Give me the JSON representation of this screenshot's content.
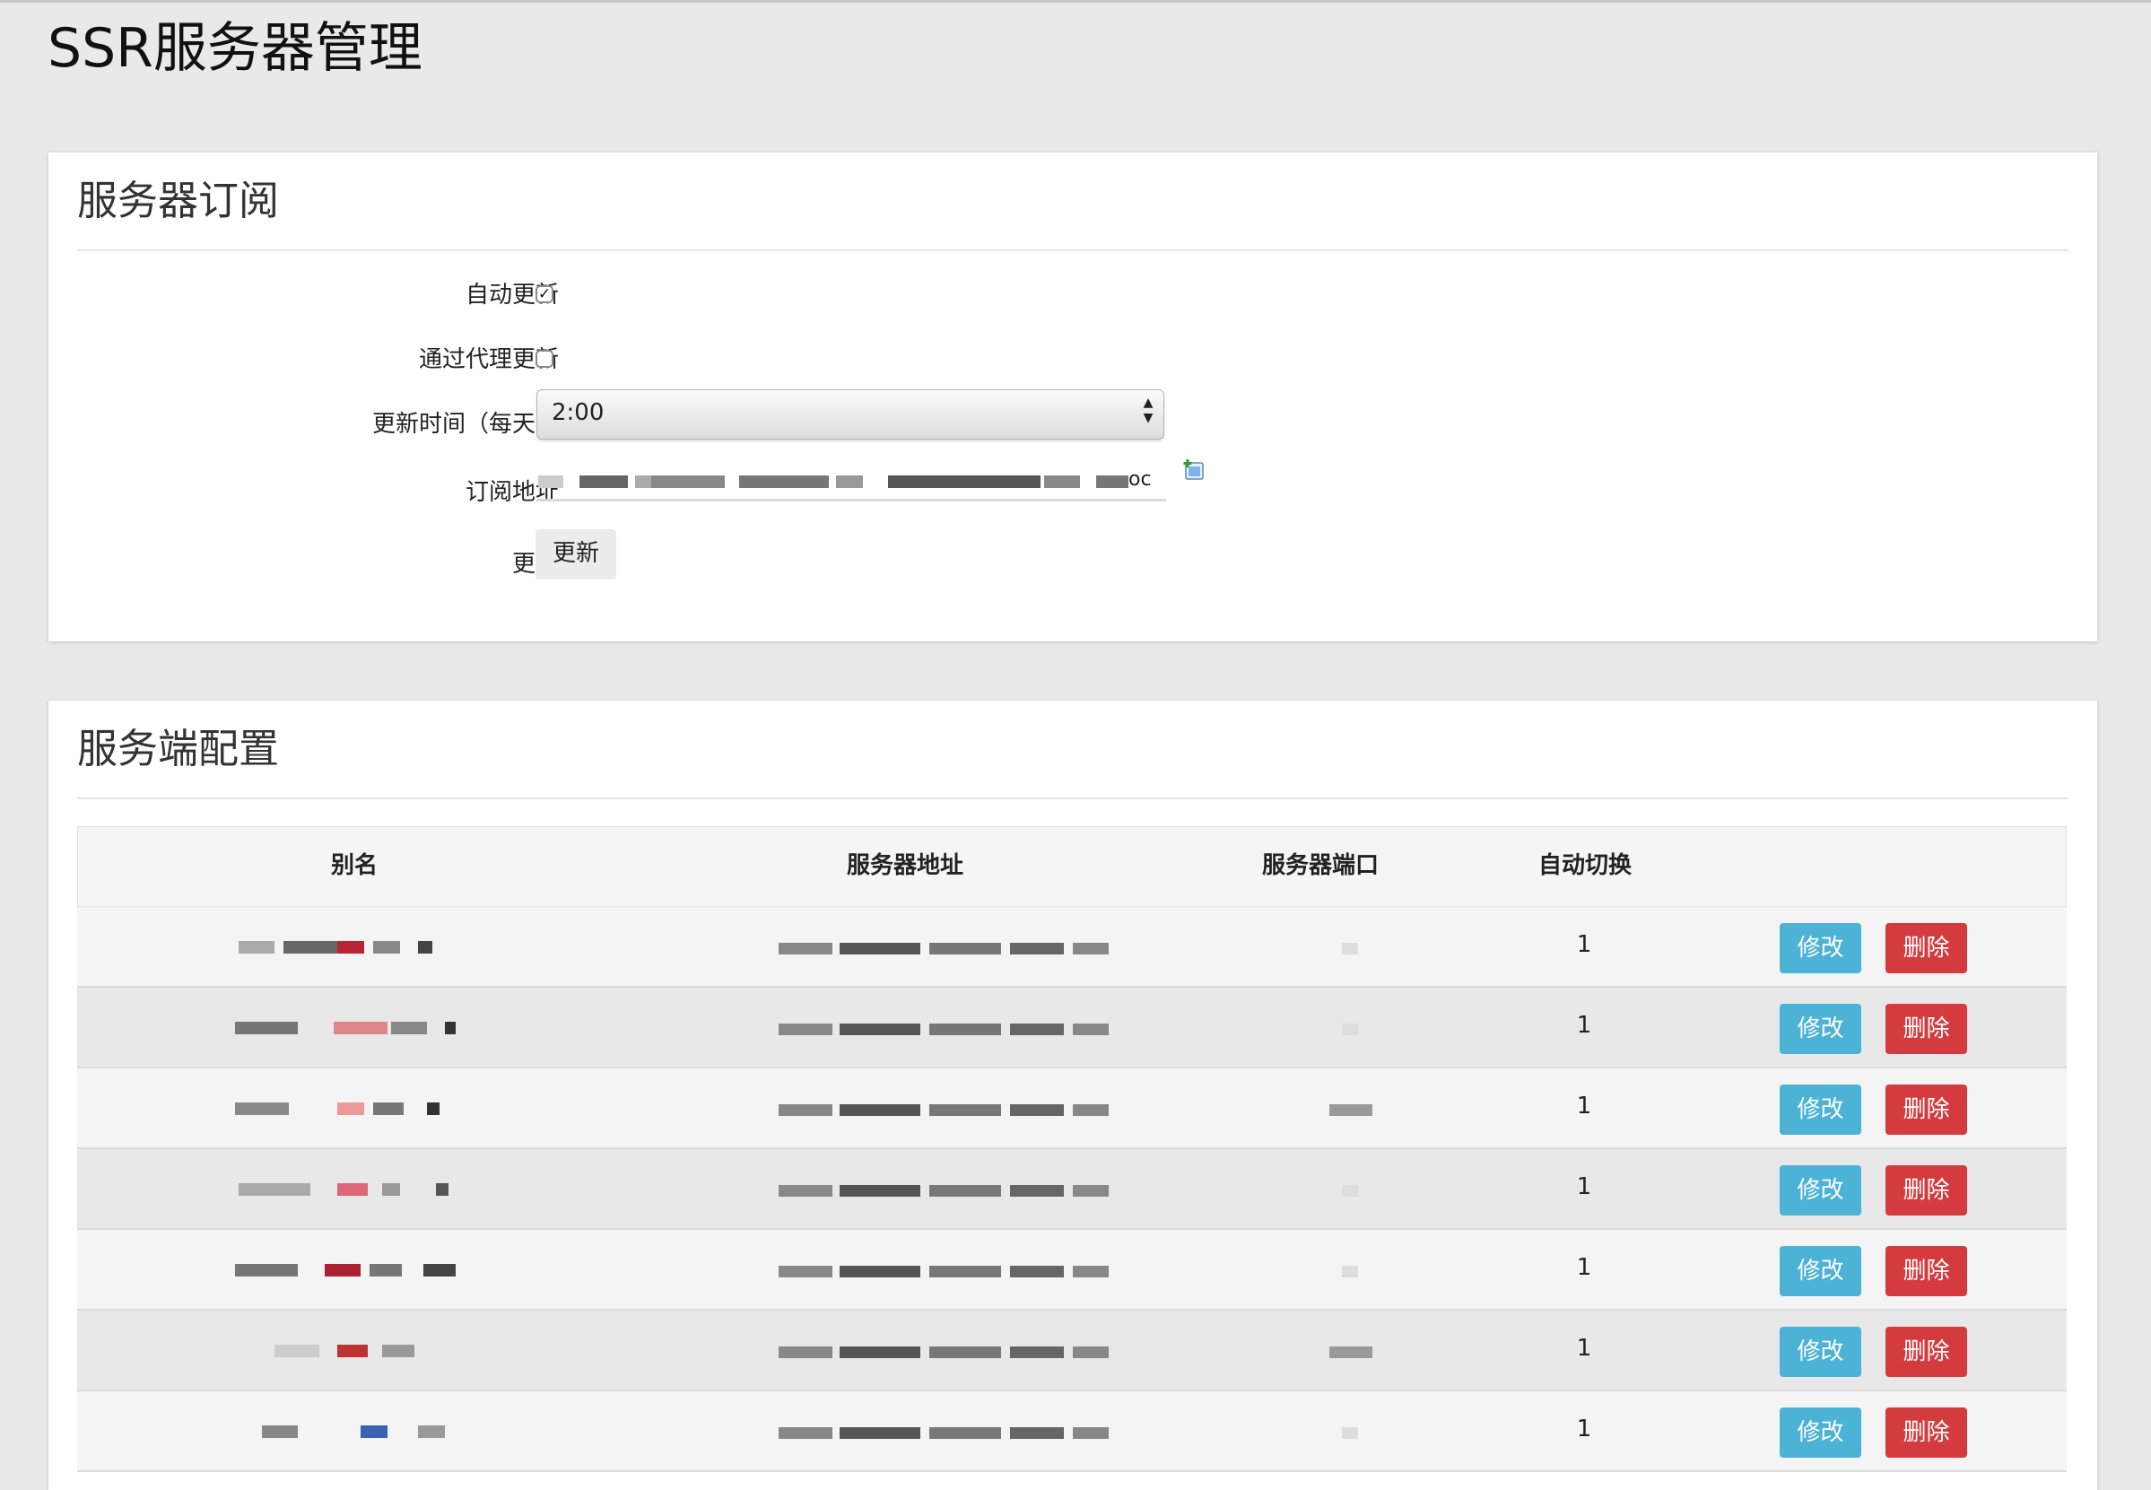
{
  "page": {
    "title": "SSR服务器管理"
  },
  "subscription": {
    "title": "服务器订阅",
    "auto_update_label": "自动更新",
    "auto_update_checked": true,
    "proxy_update_label": "通过代理更新",
    "proxy_update_checked": false,
    "update_time_label": "更新时间（每天）",
    "update_time_value": "2:00",
    "url_label": "订阅地址",
    "url_visible_suffix": "oc",
    "update_label": "更新",
    "update_button": "更新"
  },
  "servers": {
    "title": "服务端配置",
    "columns": [
      "别名",
      "服务器地址",
      "服务器端口",
      "自动切换",
      ""
    ],
    "rows": [
      {
        "auto_switch": "1",
        "edit": "修改",
        "delete": "删除"
      },
      {
        "auto_switch": "1",
        "edit": "修改",
        "delete": "删除"
      },
      {
        "auto_switch": "1",
        "edit": "修改",
        "delete": "删除"
      },
      {
        "auto_switch": "1",
        "edit": "修改",
        "delete": "删除"
      },
      {
        "auto_switch": "1",
        "edit": "修改",
        "delete": "删除"
      },
      {
        "auto_switch": "1",
        "edit": "修改",
        "delete": "删除"
      },
      {
        "auto_switch": "1",
        "edit": "修改",
        "delete": "删除"
      }
    ]
  },
  "colors": {
    "edit_button": "#4cb2d6",
    "delete_button": "#d43b3f",
    "background": "#e9e9e9"
  }
}
